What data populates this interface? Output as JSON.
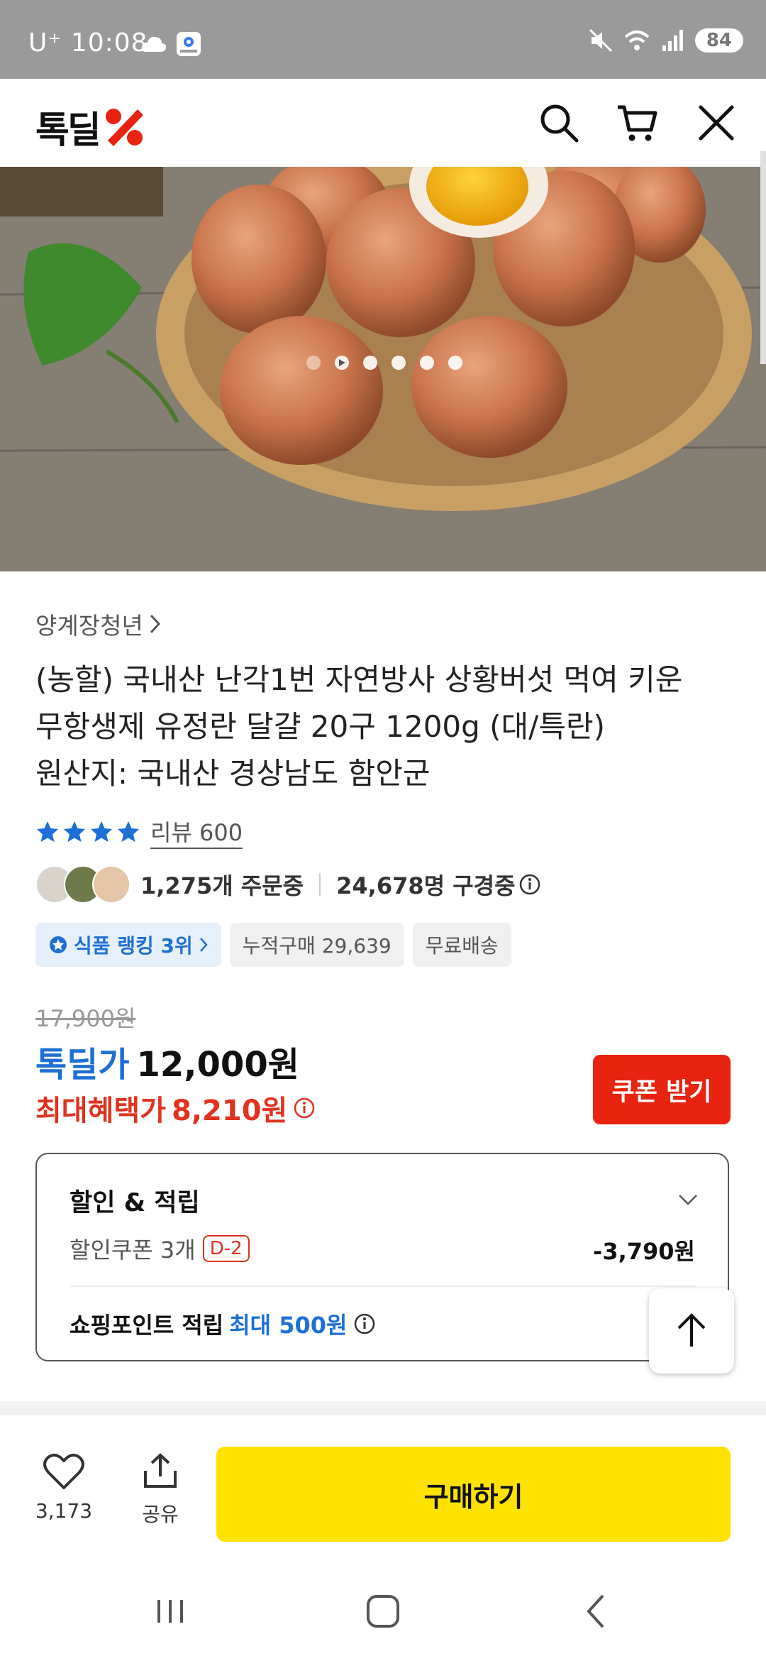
{
  "status_bar": {
    "time": "U⁺ 10:08",
    "battery": "84"
  },
  "app_bar": {
    "logo_text": "톡딜",
    "icons": [
      "search-icon",
      "cart-icon",
      "close-icon"
    ]
  },
  "hero": {
    "carousel_dots": 6,
    "active_dot": 0
  },
  "product": {
    "seller": "양계장청년",
    "title_lines": [
      "(농할) 국내산 난각1번 자연방사 상황버섯 먹여 키운",
      "무항생제 유정란 달걀 20구 1200g (대/특란)",
      "원산지: 국내산 경상남도 함안군"
    ],
    "rating_stars": 4,
    "review_label": "리뷰 600",
    "orders": "1,275개 주문중",
    "viewers": "24,678명 구경중",
    "chips": {
      "rank": "식품 랭킹 3위",
      "cumulative": "누적구매 29,639",
      "shipping": "무료배송"
    }
  },
  "price": {
    "original": "17,900원",
    "deal_label": "톡딜가",
    "deal_price": "12,000원",
    "max_label": "최대혜택가",
    "max_price": "8,210원",
    "coupon_button": "쿠폰 받기"
  },
  "discount": {
    "title": "할인 & 적립",
    "coupon_label": "할인쿠폰 3개",
    "coupon_dday": "D-2",
    "coupon_amount": "-3,790원",
    "point_label": "쇼핑포인트 적립",
    "point_highlight": "최대 500원"
  },
  "bottom_bar": {
    "like_count": "3,173",
    "share_label": "공유",
    "buy_label": "구매하기"
  },
  "colors": {
    "accent_blue": "#1d6fd6",
    "accent_red": "#e0321e",
    "buy_yellow": "#ffe200",
    "coupon_red": "#e8230f"
  }
}
